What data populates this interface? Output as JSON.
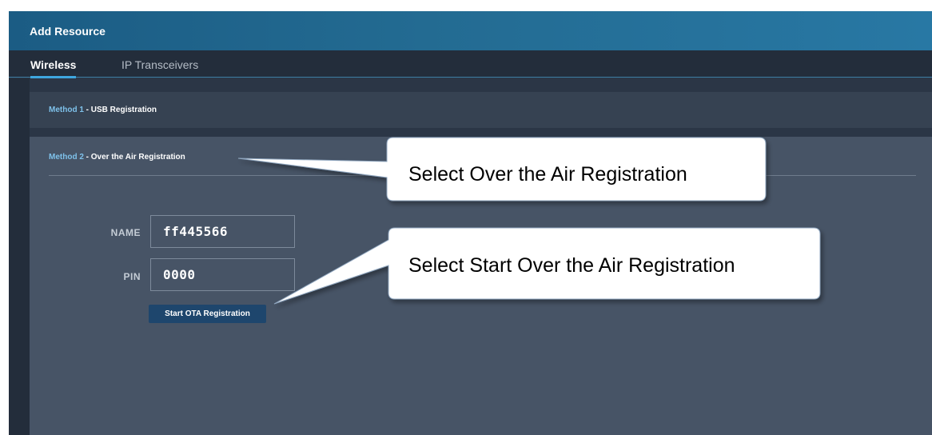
{
  "window": {
    "title": "Add Resource"
  },
  "tabs": [
    {
      "label": "Wireless",
      "active": true
    },
    {
      "label": "IP Transceivers",
      "active": false
    }
  ],
  "methods": [
    {
      "number": "Method 1",
      "separator": " - ",
      "name": "USB Registration"
    },
    {
      "number": "Method 2",
      "separator": " - ",
      "name": "Over the Air Registration"
    }
  ],
  "form": {
    "name_label": "NAME",
    "name_value": "ff445566",
    "pin_label": "PIN",
    "pin_value": "0000",
    "start_button": "Start OTA Registration"
  },
  "callouts": [
    {
      "text": "Select Over the Air Registration"
    },
    {
      "text": "Select Start Over the Air Registration"
    }
  ],
  "colors": {
    "header_gradient_start": "#1b5c84",
    "header_gradient_end": "#2878a4",
    "active_tab_underline": "#3ea6df",
    "method_number": "#7ec1ea",
    "panel_bg": "#475466",
    "button_bg": "#1e466d"
  }
}
